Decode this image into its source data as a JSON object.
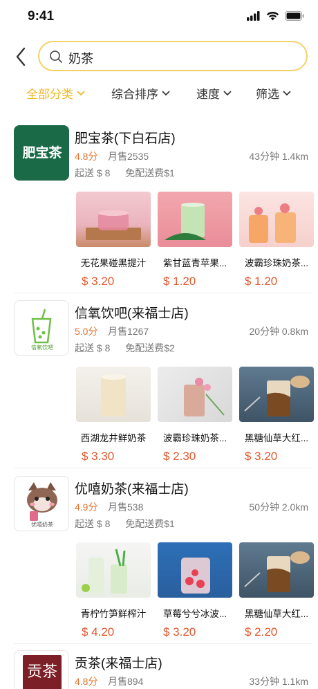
{
  "status": {
    "time": "9:41"
  },
  "search": {
    "query": "奶茶"
  },
  "filters": [
    {
      "label": "全部分类",
      "active": true
    },
    {
      "label": "综合排序",
      "active": false
    },
    {
      "label": "速度",
      "active": false
    },
    {
      "label": "筛选",
      "active": false
    }
  ],
  "shops": [
    {
      "name": "肥宝茶(下白石店)",
      "logo_text": "肥宝茶",
      "rating": "4.8分",
      "sales": "月售2535",
      "distance": "43分钟 1.4km",
      "min_order": "起送 $ 8",
      "delivery": "免配送费$1",
      "products": [
        {
          "name": "无花果碰黑提汁",
          "price": "$ 3.20",
          "image": "pink-drink-glass"
        },
        {
          "name": "紫甘蓝青苹果...",
          "price": "$ 1.20",
          "image": "green-drink-glass"
        },
        {
          "name": "波霸珍珠奶茶...",
          "price": "$ 1.20",
          "image": "peach-drink-glass"
        }
      ]
    },
    {
      "name": "信氧饮吧(来福士店)",
      "logo_text": "信氧饮吧",
      "rating": "5.0分",
      "sales": "月售1267",
      "distance": "20分钟 0.8km",
      "min_order": "起送 $ 8",
      "delivery": "免配送费$2",
      "products": [
        {
          "name": "西湖龙井鲜奶茶",
          "price": "$ 3.30",
          "image": "milk-tea-cup"
        },
        {
          "name": "波霸珍珠奶茶...",
          "price": "$ 2.30",
          "image": "pink-milk-tea"
        },
        {
          "name": "黑糖仙草大红...",
          "price": "$ 3.20",
          "image": "brown-sugar-tea"
        }
      ]
    },
    {
      "name": "优嘻奶茶(来福士店)",
      "logo_text": "优嘻奶茶",
      "rating": "4.9分",
      "sales": "月售538",
      "distance": "50分钟 2.0km",
      "min_order": "起送 $ 8",
      "delivery": "免配送费$1",
      "products": [
        {
          "name": "青柠竹笋鲜榨汁",
          "price": "$ 4.20",
          "image": "lime-drinks"
        },
        {
          "name": "草莓兮兮冰波...",
          "price": "$ 3.20",
          "image": "strawberry-drink"
        },
        {
          "name": "黑糖仙草大红...",
          "price": "$ 2.20",
          "image": "brown-sugar-tea"
        }
      ]
    },
    {
      "name": "贡茶(来福士店)",
      "logo_text": "贡茶",
      "rating": "4.8分",
      "sales": "月售894",
      "distance": "33分钟 1.1km",
      "products": []
    }
  ]
}
